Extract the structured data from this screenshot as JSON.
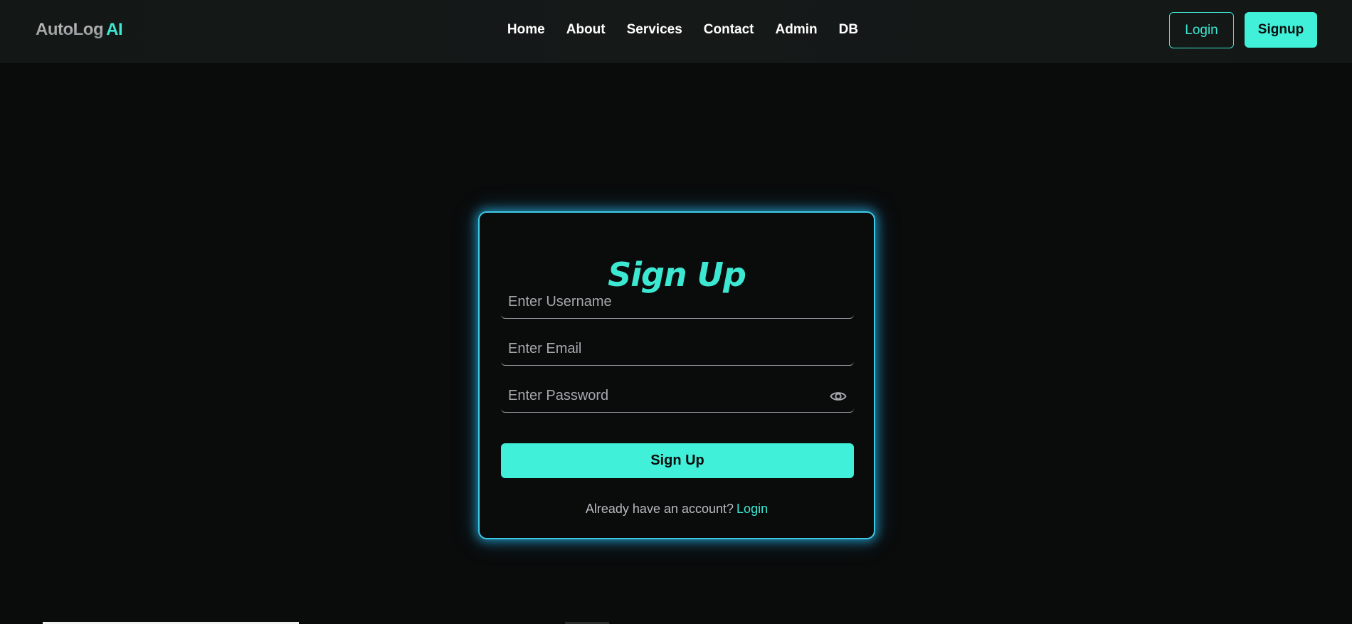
{
  "navbar": {
    "logo_main": "AutoLog",
    "logo_accent": "AI",
    "links": [
      "Home",
      "About",
      "Services",
      "Contact",
      "Admin",
      "DB"
    ],
    "login_label": "Login",
    "signup_label": "Signup"
  },
  "form": {
    "title": "Sign Up",
    "username_placeholder": "Enter Username",
    "email_placeholder": "Enter Email",
    "password_placeholder": "Enter Password",
    "submit_label": "Sign Up",
    "footer_text": "Already have an account?",
    "footer_link": "Login"
  },
  "icons": {
    "password_toggle": "eye-icon"
  },
  "colors": {
    "accent": "#40f0d9",
    "background": "#0a0b0b",
    "card_border": "#3ec9e6"
  }
}
